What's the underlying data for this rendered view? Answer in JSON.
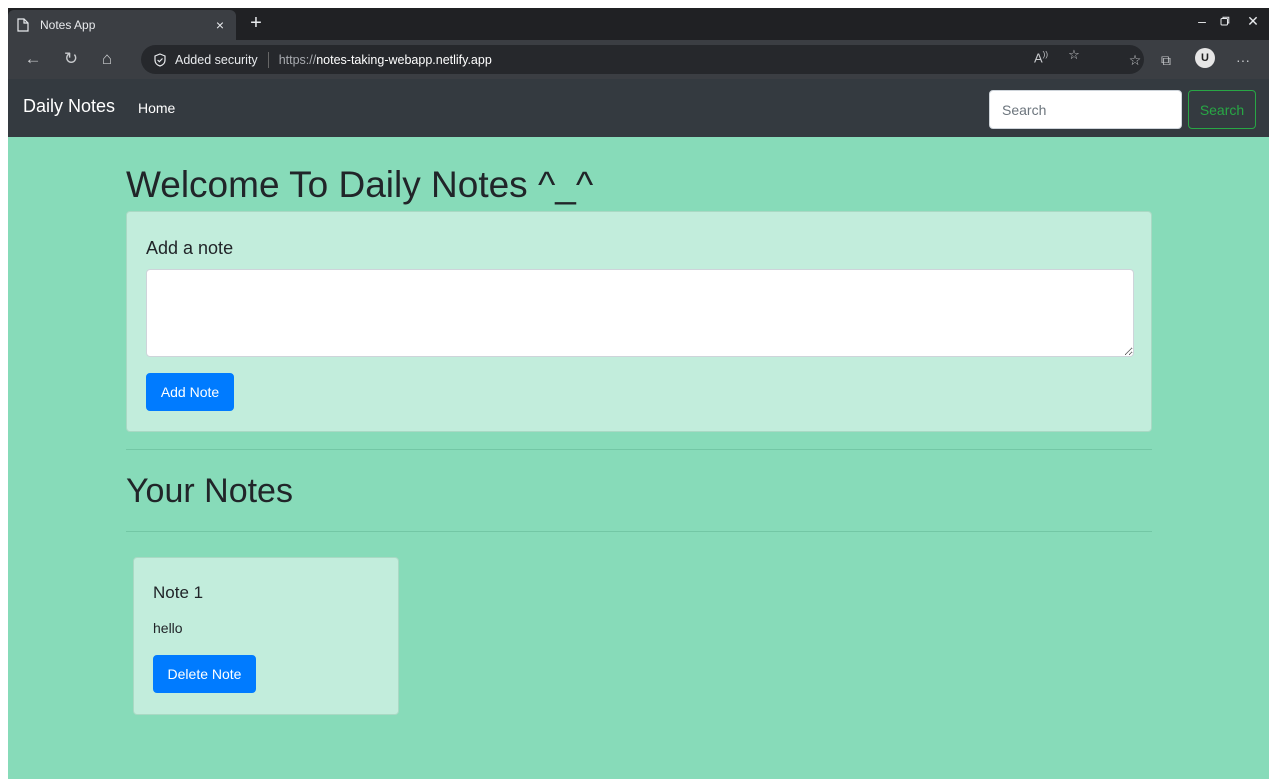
{
  "browser": {
    "tab_title": "Notes App",
    "tab_close": "×",
    "new_tab": "+",
    "security_label": "Added security",
    "url_prefix": "https://",
    "url_host": "notes-taking-webapp.netlify.app",
    "more": "···"
  },
  "navbar": {
    "brand": "Daily Notes",
    "home_link": "Home",
    "search_placeholder": "Search",
    "search_button": "Search"
  },
  "main": {
    "welcome_heading": "Welcome To Daily Notes ^_^",
    "add_card_title": "Add a note",
    "add_button": "Add Note",
    "your_notes_heading": "Your Notes"
  },
  "notes": [
    {
      "title": "Note 1",
      "body": "hello",
      "delete_label": "Delete Note"
    }
  ],
  "colors": {
    "page_background": "#87dbb9",
    "card_background": "#c2eddc",
    "navbar": "#343a40",
    "primary": "#007bff",
    "success": "#28a745"
  }
}
